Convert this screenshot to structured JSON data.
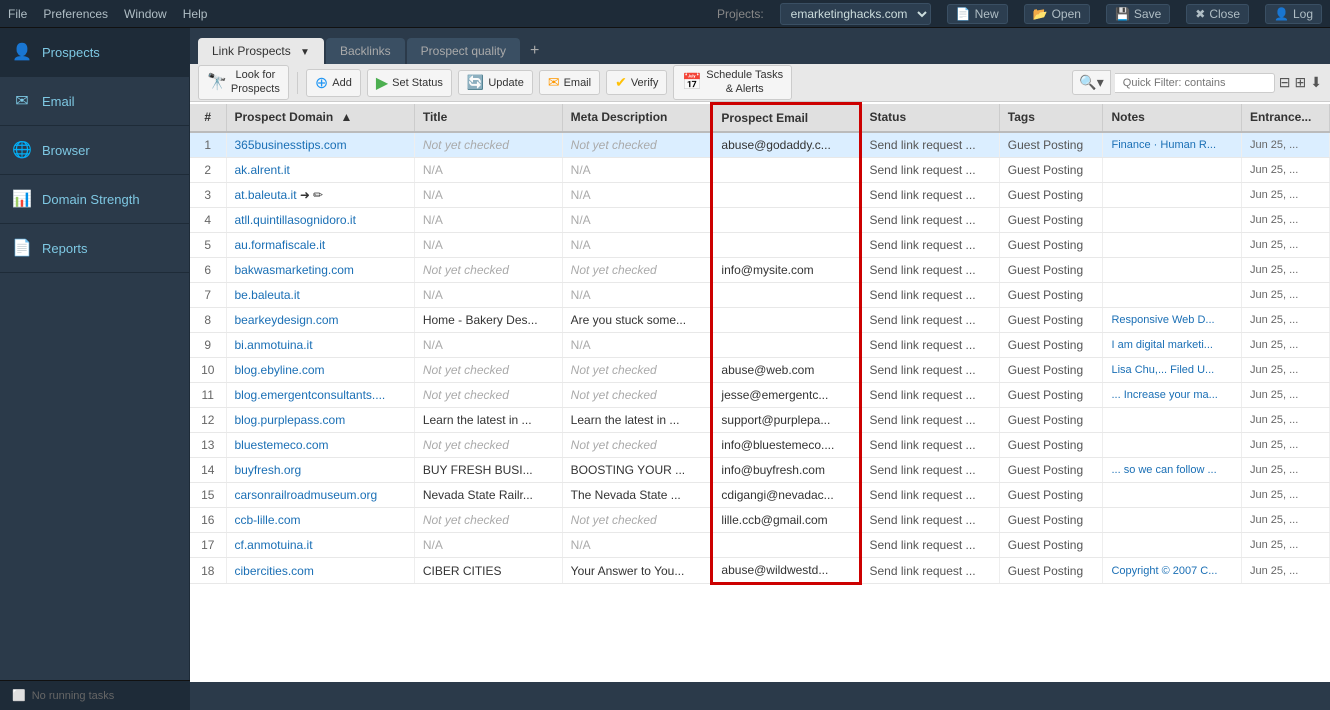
{
  "menubar": {
    "items": [
      "File",
      "Preferences",
      "Window",
      "Help"
    ]
  },
  "projects": {
    "label": "Projects:",
    "current": "emarketinghacks.com",
    "buttons": [
      "New",
      "Open",
      "Save",
      "Close",
      "Log"
    ]
  },
  "sidebar": {
    "items": [
      {
        "id": "prospects",
        "label": "Prospects",
        "icon": "👤"
      },
      {
        "id": "email",
        "label": "Email",
        "icon": "✉"
      },
      {
        "id": "browser",
        "label": "Browser",
        "icon": "🌐"
      },
      {
        "id": "domain-strength",
        "label": "Domain Strength",
        "icon": "📊"
      },
      {
        "id": "reports",
        "label": "Reports",
        "icon": "📄"
      }
    ],
    "footer": "No running tasks"
  },
  "tabs": [
    {
      "id": "link-prospects",
      "label": "Link Prospects",
      "active": true
    },
    {
      "id": "backlinks",
      "label": "Backlinks",
      "active": false
    },
    {
      "id": "prospect-quality",
      "label": "Prospect quality",
      "active": false
    }
  ],
  "actionbar": {
    "buttons": [
      {
        "id": "look-for-prospects",
        "label": "Look for\nProspects",
        "icon": "🔍"
      },
      {
        "id": "add",
        "label": "Add",
        "icon": "➕"
      },
      {
        "id": "set-status",
        "label": "Set Status",
        "icon": "▶"
      },
      {
        "id": "update",
        "label": "Update",
        "icon": "🔄"
      },
      {
        "id": "email",
        "label": "Email",
        "icon": "✉"
      },
      {
        "id": "verify",
        "label": "Verify",
        "icon": "✔"
      },
      {
        "id": "schedule-tasks",
        "label": "Schedule Tasks\n& Alerts",
        "icon": "📅"
      }
    ],
    "filter": {
      "placeholder": "Quick Filter: contains"
    }
  },
  "table": {
    "columns": [
      "#",
      "Prospect Domain",
      "Title",
      "Meta Description",
      "Prospect Email",
      "Status",
      "Tags",
      "Notes",
      "Entrance..."
    ],
    "rows": [
      {
        "num": 1,
        "domain": "365businesstips.com",
        "title": "Not yet checked",
        "meta": "Not yet checked",
        "email": "abuse@godaddy.c...",
        "status": "Send link request ...",
        "tags": "Guest Posting",
        "notes": "Finance · Human R...",
        "entrance": "Jun 25, ..."
      },
      {
        "num": 2,
        "domain": "ak.alrent.it",
        "title": "N/A",
        "meta": "N/A",
        "email": "",
        "status": "Send link request ...",
        "tags": "Guest Posting",
        "notes": "",
        "entrance": "Jun 25, ..."
      },
      {
        "num": 3,
        "domain": "at.baleuta.it",
        "title": "N/A",
        "meta": "N/A",
        "email": "",
        "status": "Send link request ...",
        "tags": "Guest Posting",
        "notes": "",
        "entrance": "Jun 25, ..."
      },
      {
        "num": 4,
        "domain": "atll.quintillasognidoro.it",
        "title": "N/A",
        "meta": "N/A",
        "email": "",
        "status": "Send link request ...",
        "tags": "Guest Posting",
        "notes": "",
        "entrance": "Jun 25, ..."
      },
      {
        "num": 5,
        "domain": "au.formafiscale.it",
        "title": "N/A",
        "meta": "N/A",
        "email": "",
        "status": "Send link request ...",
        "tags": "Guest Posting",
        "notes": "",
        "entrance": "Jun 25, ..."
      },
      {
        "num": 6,
        "domain": "bakwasmarketing.com",
        "title": "Not yet checked",
        "meta": "Not yet checked",
        "email": "info@mysite.com",
        "status": "Send link request ...",
        "tags": "Guest Posting",
        "notes": "",
        "entrance": "Jun 25, ..."
      },
      {
        "num": 7,
        "domain": "be.baleuta.it",
        "title": "N/A",
        "meta": "N/A",
        "email": "",
        "status": "Send link request ...",
        "tags": "Guest Posting",
        "notes": "",
        "entrance": "Jun 25, ..."
      },
      {
        "num": 8,
        "domain": "bearkeydesign.com",
        "title": "Home - Bakery Des...",
        "meta": "Are you stuck some...",
        "email": "",
        "status": "Send link request ...",
        "tags": "Guest Posting",
        "notes": "Responsive Web D...",
        "entrance": "Jun 25, ..."
      },
      {
        "num": 9,
        "domain": "bi.anmotuina.it",
        "title": "N/A",
        "meta": "N/A",
        "email": "",
        "status": "Send link request ...",
        "tags": "Guest Posting",
        "notes": "I am digital marketi...",
        "entrance": "Jun 25, ..."
      },
      {
        "num": 10,
        "domain": "blog.ebyline.com",
        "title": "Not yet checked",
        "meta": "Not yet checked",
        "email": "abuse@web.com",
        "status": "Send link request ...",
        "tags": "Guest Posting",
        "notes": "Lisa Chu,... Filed U...",
        "entrance": "Jun 25, ..."
      },
      {
        "num": 11,
        "domain": "blog.emergentconsultants....",
        "title": "Not yet checked",
        "meta": "Not yet checked",
        "email": "jesse@emergentc...",
        "status": "Send link request ...",
        "tags": "Guest Posting",
        "notes": "... Increase your ma...",
        "entrance": "Jun 25, ..."
      },
      {
        "num": 12,
        "domain": "blog.purplepass.com",
        "title": "Learn the latest in ...",
        "meta": "Learn the latest in ...",
        "email": "support@purplepa...",
        "status": "Send link request ...",
        "tags": "Guest Posting",
        "notes": "",
        "entrance": "Jun 25, ..."
      },
      {
        "num": 13,
        "domain": "bluestemeco.com",
        "title": "Not yet checked",
        "meta": "Not yet checked",
        "email": "info@bluestemeco....",
        "status": "Send link request ...",
        "tags": "Guest Posting",
        "notes": "",
        "entrance": "Jun 25, ..."
      },
      {
        "num": 14,
        "domain": "buyfresh.org",
        "title": "BUY FRESH BUSI...",
        "meta": "BOOSTING YOUR ...",
        "email": "info@buyfresh.com",
        "status": "Send link request ...",
        "tags": "Guest Posting",
        "notes": "... so we can follow ...",
        "entrance": "Jun 25, ..."
      },
      {
        "num": 15,
        "domain": "carsonrailroadmuseum.org",
        "title": "Nevada State Railr...",
        "meta": "The Nevada State ...",
        "email": "cdigangi@nevadac...",
        "status": "Send link request ...",
        "tags": "Guest Posting",
        "notes": "",
        "entrance": "Jun 25, ..."
      },
      {
        "num": 16,
        "domain": "ccb-lille.com",
        "title": "Not yet checked",
        "meta": "Not yet checked",
        "email": "lille.ccb@gmail.com",
        "status": "Send link request ...",
        "tags": "Guest Posting",
        "notes": "",
        "entrance": "Jun 25, ..."
      },
      {
        "num": 17,
        "domain": "cf.anmotuina.it",
        "title": "N/A",
        "meta": "N/A",
        "email": "",
        "status": "Send link request ...",
        "tags": "Guest Posting",
        "notes": "",
        "entrance": "Jun 25, ..."
      },
      {
        "num": 18,
        "domain": "cibercities.com",
        "title": "CIBER CITIES",
        "meta": "Your Answer to You...",
        "email": "abuse@wildwestd...",
        "status": "Send link request ...",
        "tags": "Guest Posting",
        "notes": "Copyright © 2007 C...",
        "entrance": "Jun 25, ..."
      }
    ]
  }
}
